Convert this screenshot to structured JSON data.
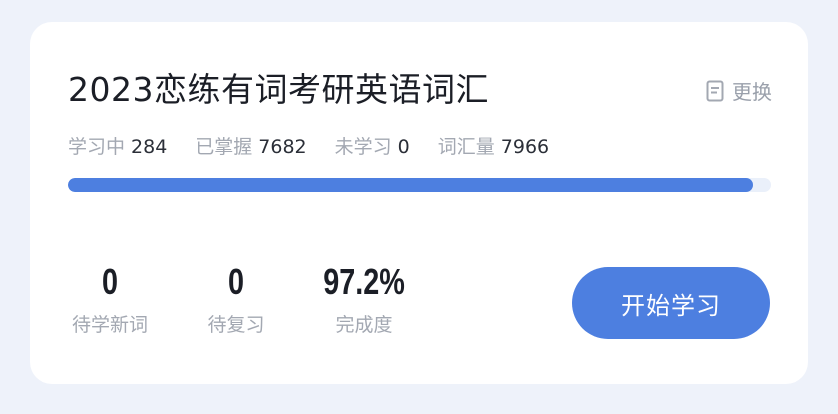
{
  "card": {
    "title": "2023恋练有词考研英语词汇",
    "change_label": "更换",
    "stats": [
      {
        "label": "学习中",
        "value": "284"
      },
      {
        "label": "已掌握",
        "value": "7682"
      },
      {
        "label": "未学习",
        "value": "0"
      },
      {
        "label": "词汇量",
        "value": "7966"
      }
    ],
    "progress_fraction": 0.975,
    "metrics": [
      {
        "value": "0",
        "label": "待学新词"
      },
      {
        "value": "0",
        "label": "待复习"
      },
      {
        "value": "97.2%",
        "label": "完成度"
      }
    ],
    "start_label": "开始学习"
  },
  "colors": {
    "accent": "#4d7fe0",
    "progress_track": "#eaf0fa",
    "muted_text": "#a3a8b2",
    "title_text": "#1b1e26"
  },
  "icons": {
    "change": "document-icon"
  }
}
